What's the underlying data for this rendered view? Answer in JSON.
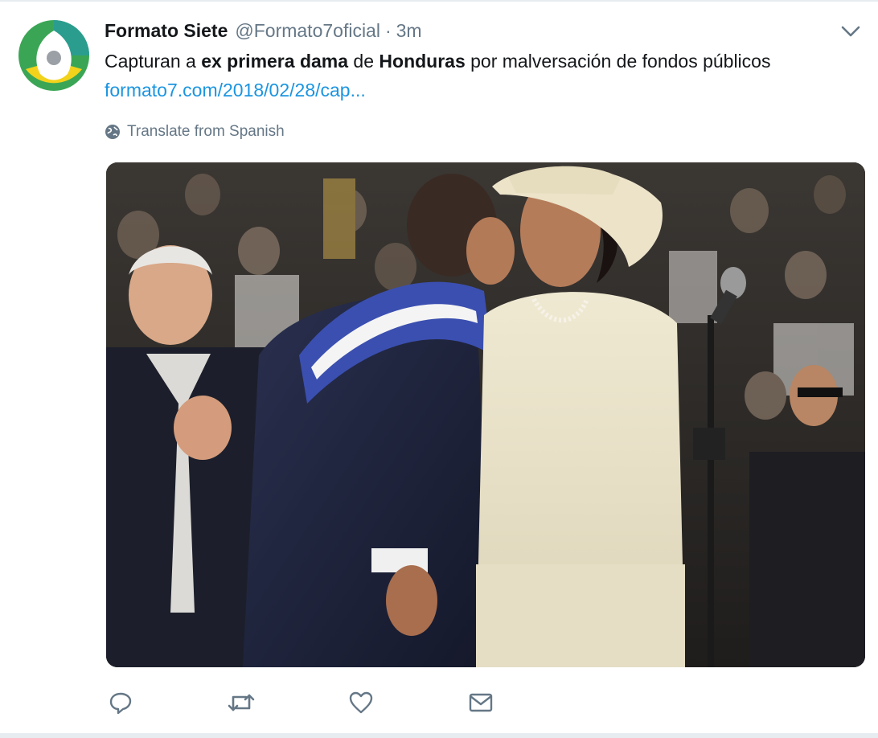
{
  "tweet": {
    "author_name": "Formato Siete",
    "handle": "@Formato7oficial",
    "separator": "·",
    "timestamp": "3m",
    "text_parts": {
      "p1": "Capturan a ",
      "b1": "ex primera dama",
      "p2": " de ",
      "b2": "Honduras",
      "p3": " por malversación de fondos públicos"
    },
    "link_text": "formato7.com/2018/02/28/cap...",
    "translate_label": "Translate from Spanish"
  },
  "icons": {
    "avatar": "formato-siete-logo",
    "caret": "chevron-down-icon",
    "globe": "globe-icon",
    "reply": "reply-icon",
    "retweet": "retweet-icon",
    "like": "heart-icon",
    "message": "envelope-icon"
  },
  "colors": {
    "link": "#1b95e0",
    "secondary_text": "#657786",
    "logo_green": "#3aa655",
    "logo_teal": "#2a9d8f",
    "logo_yellow": "#f2d21b"
  }
}
